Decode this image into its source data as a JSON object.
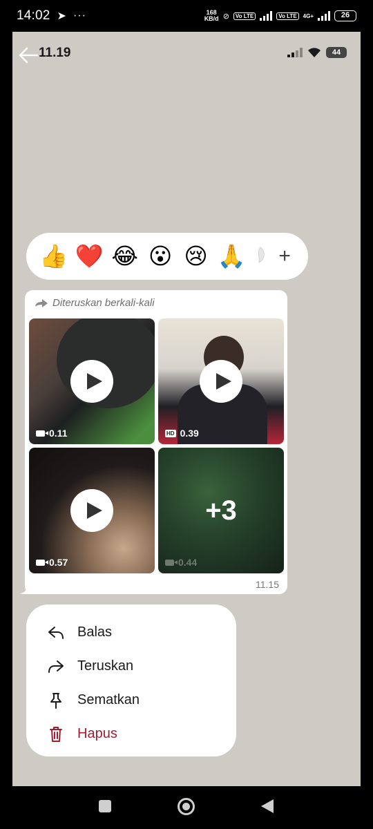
{
  "status_bar": {
    "time": "14:02",
    "network_speed_top": "168",
    "network_speed_unit": "KB/d",
    "volte1": "Vo LTE",
    "volte2": "Vo LTE",
    "network_type": "4G+",
    "battery": "26"
  },
  "inner_status": {
    "time": "11.19",
    "battery": "44"
  },
  "reactions": [
    {
      "name": "thumbs-up",
      "glyph": "👍"
    },
    {
      "name": "heart",
      "glyph": "❤️"
    },
    {
      "name": "tears-of-joy",
      "glyph": "😂"
    },
    {
      "name": "surprised",
      "glyph": "😮"
    },
    {
      "name": "crying",
      "glyph": "😢"
    },
    {
      "name": "folded-hands",
      "glyph": "🙏"
    }
  ],
  "reactions_add": "+",
  "message": {
    "forwarded_label": "Diteruskan berkali-kali",
    "time": "11.15",
    "media": [
      {
        "duration": "0.11",
        "hd": false
      },
      {
        "duration": "0.39",
        "hd": true,
        "hd_label": "HD"
      },
      {
        "duration": "0.57",
        "hd": false
      },
      {
        "duration": "0.44",
        "hd": false,
        "more_label": "+3"
      }
    ]
  },
  "menu": {
    "reply": "Balas",
    "forward": "Teruskan",
    "pin": "Sematkan",
    "delete": "Hapus"
  },
  "colors": {
    "screen_bg": "#cecbc5",
    "danger": "#a01d31",
    "bubble": "#ffffff"
  }
}
